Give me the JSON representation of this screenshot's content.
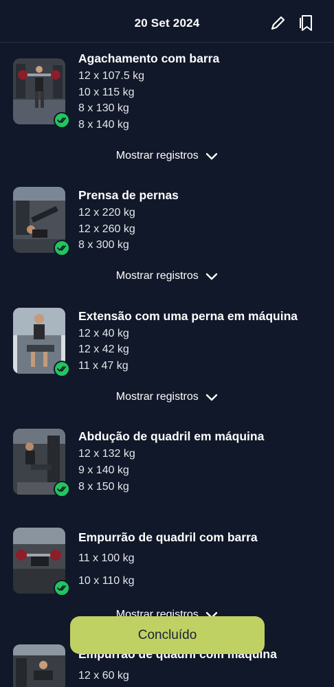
{
  "header": {
    "title": "20 Set 2024",
    "edit_icon": "pencil-icon",
    "bookmark_icon": "bookmark-icon"
  },
  "exercises": [
    {
      "name": "Agachamento com barra",
      "sets": [
        "12 x 107.5 kg",
        "10 x 115 kg",
        "8 x 130 kg",
        "8 x 140 kg"
      ],
      "toggle_label": "Mostrar registros"
    },
    {
      "name": "Prensa de pernas",
      "sets": [
        "12 x 220 kg",
        "12 x 260 kg",
        "8 x 300 kg"
      ],
      "toggle_label": "Mostrar registros"
    },
    {
      "name": "Extensão com uma perna em máquina",
      "sets": [
        "12 x 40 kg",
        "12 x 42 kg",
        "11 x 47 kg"
      ],
      "toggle_label": "Mostrar registros"
    },
    {
      "name": "Abdução de quadril em máquina",
      "sets": [
        "12 x 132 kg",
        "9 x 140 kg",
        "8 x 150 kg"
      ],
      "toggle_label": "Mostrar registros"
    },
    {
      "name": "Empurrão de quadril com barra",
      "sets": [
        "11 x 100 kg",
        "10 x 110 kg"
      ],
      "toggle_label": "Mostrar registros"
    },
    {
      "name": "Empurrão de quadril com máquina",
      "sets": [
        "12 x 60 kg"
      ]
    }
  ],
  "done_button": {
    "label": "Concluído"
  },
  "colors": {
    "background": "#111829",
    "check_green": "#22c55e",
    "done_button": "#bfd163"
  }
}
